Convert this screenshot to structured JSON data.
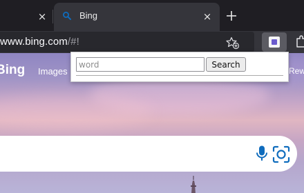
{
  "browser": {
    "tabs": [
      {
        "label": "",
        "close_glyph": "×"
      },
      {
        "label": "Bing",
        "icon": "search-icon",
        "close_glyph": "×"
      }
    ],
    "new_tab_icon": "plus-icon",
    "address_bar": {
      "host": "www.bing.com",
      "path": "/#!"
    },
    "toolbar_icons": [
      "bookmark-add-icon",
      "extension-icon",
      "puzzle-icon"
    ]
  },
  "page": {
    "logo": "Bing",
    "nav": {
      "images": "Images",
      "rewards": "Rewar"
    },
    "search_icons": [
      "microphone-icon",
      "visual-search-icon"
    ]
  },
  "popup": {
    "input": {
      "value": "",
      "placeholder": "word"
    },
    "button_label": "Search"
  },
  "colors": {
    "accent_blue": "#0f6cbd",
    "tab_bg": "#35353b",
    "tabstrip_bg": "#1f1e23"
  }
}
